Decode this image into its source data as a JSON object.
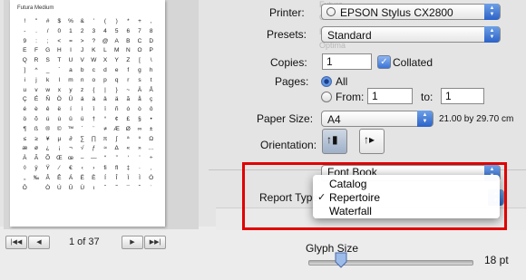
{
  "preview": {
    "page_title": "Futura Medium",
    "glyphs": [
      "!",
      "\"",
      "#",
      "$",
      "%",
      "&",
      "'",
      "(",
      ")",
      "*",
      "+",
      ",",
      "-",
      ".",
      "/",
      "0",
      "1",
      "2",
      "3",
      "4",
      "5",
      "6",
      "7",
      "8",
      "9",
      ":",
      ";",
      "<",
      "=",
      ">",
      "?",
      "@",
      "A",
      "B",
      "C",
      "D",
      "E",
      "F",
      "G",
      "H",
      "I",
      "J",
      "K",
      "L",
      "M",
      "N",
      "O",
      "P",
      "Q",
      "R",
      "S",
      "T",
      "U",
      "V",
      "W",
      "X",
      "Y",
      "Z",
      "[",
      "\\",
      "]",
      "^",
      "_",
      "`",
      "a",
      "b",
      "c",
      "d",
      "e",
      "f",
      "g",
      "h",
      "i",
      "j",
      "k",
      "l",
      "m",
      "n",
      "o",
      "p",
      "q",
      "r",
      "s",
      "t",
      "u",
      "v",
      "w",
      "x",
      "y",
      "z",
      "{",
      "|",
      "}",
      "~",
      "Ä",
      "Å",
      "Ç",
      "É",
      "Ñ",
      "Ö",
      "Ü",
      "á",
      "à",
      "â",
      "ä",
      "ã",
      "å",
      "ç",
      "é",
      "è",
      "ê",
      "ë",
      "í",
      "ì",
      "î",
      "ï",
      "ñ",
      "ó",
      "ò",
      "ô",
      "ö",
      "õ",
      "ú",
      "ù",
      "û",
      "ü",
      "†",
      "°",
      "¢",
      "£",
      "§",
      "•",
      "¶",
      "ß",
      "®",
      "©",
      "™",
      "´",
      "¨",
      "≠",
      "Æ",
      "Ø",
      "∞",
      "±",
      "≤",
      "≥",
      "¥",
      "µ",
      "∂",
      "∑",
      "∏",
      "π",
      "∫",
      "ª",
      "º",
      "Ω",
      "æ",
      "ø",
      "¿",
      "¡",
      "¬",
      "√",
      "ƒ",
      "≈",
      "∆",
      "«",
      "»",
      "…",
      "À",
      "Ã",
      "Õ",
      "Œ",
      "œ",
      "–",
      "—",
      "“",
      "”",
      "‘",
      "’",
      "÷",
      "◊",
      "ÿ",
      "Ÿ",
      "⁄",
      "€",
      "‹",
      "›",
      "ﬁ",
      "ﬂ",
      "‡",
      "·",
      "‚",
      "„",
      "‰",
      "Â",
      "Ê",
      "Á",
      "Ë",
      "È",
      "Í",
      "Î",
      "Ï",
      "Ì",
      "Ó",
      "Ô",
      "",
      "Ò",
      "Ú",
      "Û",
      "Ù",
      "ı",
      "ˆ",
      "˜",
      "¯",
      "˘",
      "˙",
      "˚",
      "¸",
      "˝",
      "˛",
      "ˇ",
      "Ł",
      "ł",
      "Š",
      "š",
      "Ž",
      "ž",
      "¦",
      "Ð",
      "ð",
      "Ý",
      "ý",
      "Þ",
      "þ",
      "−",
      "×",
      "¹",
      "²",
      "³",
      "½",
      "¼",
      "¾",
      "₣",
      "Ğ",
      "ğ",
      "İ",
      "Ş",
      "ş",
      "Ć",
      "ć",
      "Č",
      "č",
      "đ"
    ],
    "page_counter": "1 of 37"
  },
  "printer": {
    "label": "Printer:",
    "value": "EPSON Stylus CX2800"
  },
  "presets": {
    "label": "Presets:",
    "value": "Standard"
  },
  "copies": {
    "label": "Copies:",
    "value": "1",
    "collated_label": "Collated"
  },
  "pages": {
    "label": "Pages:",
    "all_label": "All",
    "from_label": "From:",
    "from_value": "1",
    "to_label": "to:",
    "to_value": "1"
  },
  "paper_size": {
    "label": "Paper Size:",
    "value": "A4",
    "dimensions": "21.00 by 29.70 cm"
  },
  "orientation": {
    "label": "Orientation:"
  },
  "font_book": {
    "value": "Font Book"
  },
  "report_type": {
    "label": "Report Type",
    "options": [
      "Catalog",
      "Repertoire",
      "Waterfall"
    ],
    "selected": "Repertoire"
  },
  "glyph_size": {
    "label": "Glyph Size",
    "value_label": "18 pt",
    "level_fraction": 0.2
  },
  "colors": {
    "highlight": "#e00000",
    "accent": "#3b74d6"
  }
}
